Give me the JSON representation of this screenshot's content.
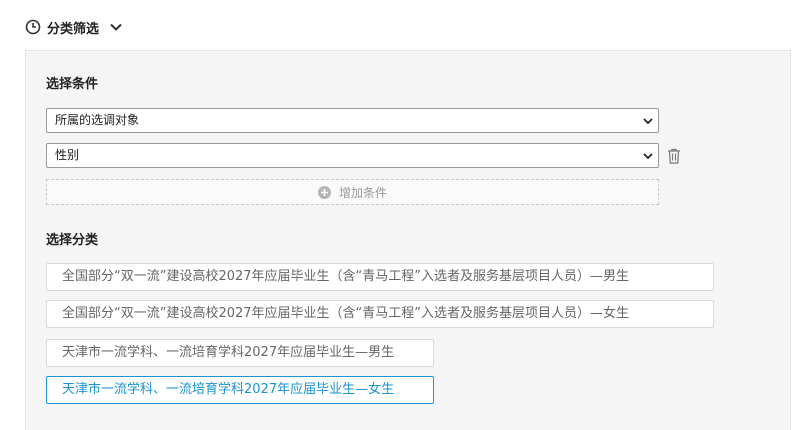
{
  "header": {
    "title": "分类筛选",
    "icon": "clock-icon",
    "toggle_icon": "chevron-down-icon"
  },
  "conditions": {
    "title": "选择条件",
    "selects": [
      {
        "value": "所属的选调对象"
      },
      {
        "value": "性别"
      }
    ],
    "add_label": "增加条件"
  },
  "categories": {
    "title": "选择分类",
    "items": [
      {
        "label": "全国部分“双一流”建设高校2027年应届毕业生（含“青马工程”入选者及服务基层项目人员）—男生",
        "selected": false
      },
      {
        "label": "全国部分“双一流”建设高校2027年应届毕业生（含“青马工程”入选者及服务基层项目人员）—女生",
        "selected": false
      },
      {
        "label": "天津市一流学科、一流培育学科2027年应届毕业生—男生",
        "selected": false
      },
      {
        "label": "天津市一流学科、一流培育学科2027年应届毕业生—女生",
        "selected": true
      }
    ]
  },
  "colors": {
    "accent": "#1a94d2",
    "panel_bg": "#f5f5f5",
    "text_muted": "#666666"
  }
}
